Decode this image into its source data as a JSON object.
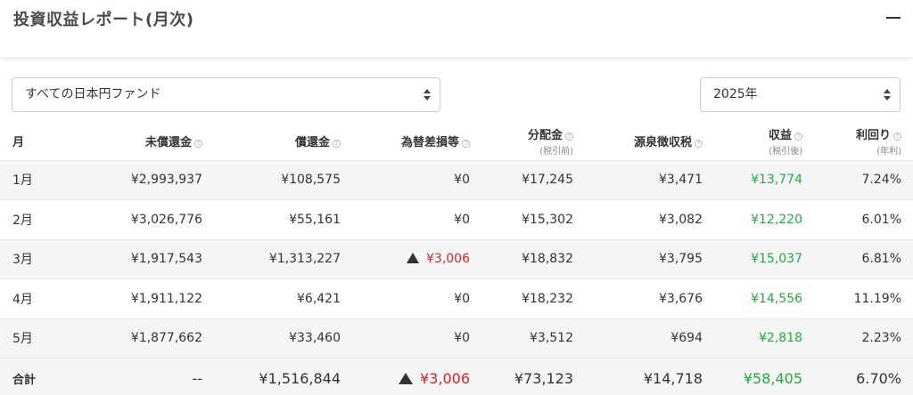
{
  "header": {
    "title": "投資収益レポート(月次)",
    "collapse_icon": "minus-icon"
  },
  "filters": {
    "fund": "すべての日本円ファンド",
    "year": "2025年"
  },
  "colors": {
    "positive": "#27a844",
    "negative": "#d9262c"
  },
  "table": {
    "columns": [
      {
        "label": "月",
        "sub": "",
        "info": false
      },
      {
        "label": "未償還金",
        "sub": "",
        "info": true
      },
      {
        "label": "償還金",
        "sub": "",
        "info": true
      },
      {
        "label": "為替差損等",
        "sub": "",
        "info": true
      },
      {
        "label": "分配金",
        "sub": "(税引前)",
        "info": true
      },
      {
        "label": "源泉徴収税",
        "sub": "",
        "info": true
      },
      {
        "label": "収益",
        "sub": "(税引後)",
        "info": true
      },
      {
        "label": "利回り",
        "sub": "(年利)",
        "info": true
      }
    ],
    "rows": [
      {
        "month": "1月",
        "unredeemed": "¥2,993,937",
        "redemption": "¥108,575",
        "fx_loss": "¥0",
        "fx_loss_negative": false,
        "distribution": "¥17,245",
        "withholding": "¥3,471",
        "profit": "¥13,774",
        "yield": "7.24%"
      },
      {
        "month": "2月",
        "unredeemed": "¥3,026,776",
        "redemption": "¥55,161",
        "fx_loss": "¥0",
        "fx_loss_negative": false,
        "distribution": "¥15,302",
        "withholding": "¥3,082",
        "profit": "¥12,220",
        "yield": "6.01%"
      },
      {
        "month": "3月",
        "unredeemed": "¥1,917,543",
        "redemption": "¥1,313,227",
        "fx_loss": "¥3,006",
        "fx_loss_negative": true,
        "distribution": "¥18,832",
        "withholding": "¥3,795",
        "profit": "¥15,037",
        "yield": "6.81%"
      },
      {
        "month": "4月",
        "unredeemed": "¥1,911,122",
        "redemption": "¥6,421",
        "fx_loss": "¥0",
        "fx_loss_negative": false,
        "distribution": "¥18,232",
        "withholding": "¥3,676",
        "profit": "¥14,556",
        "yield": "11.19%"
      },
      {
        "month": "5月",
        "unredeemed": "¥1,877,662",
        "redemption": "¥33,460",
        "fx_loss": "¥0",
        "fx_loss_negative": false,
        "distribution": "¥3,512",
        "withholding": "¥694",
        "profit": "¥2,818",
        "yield": "2.23%"
      }
    ],
    "total": {
      "month": "合計",
      "unredeemed": "--",
      "redemption": "¥1,516,844",
      "fx_loss": "¥3,006",
      "fx_loss_negative": true,
      "distribution": "¥73,123",
      "withholding": "¥14,718",
      "profit": "¥58,405",
      "yield": "6.70%"
    }
  }
}
